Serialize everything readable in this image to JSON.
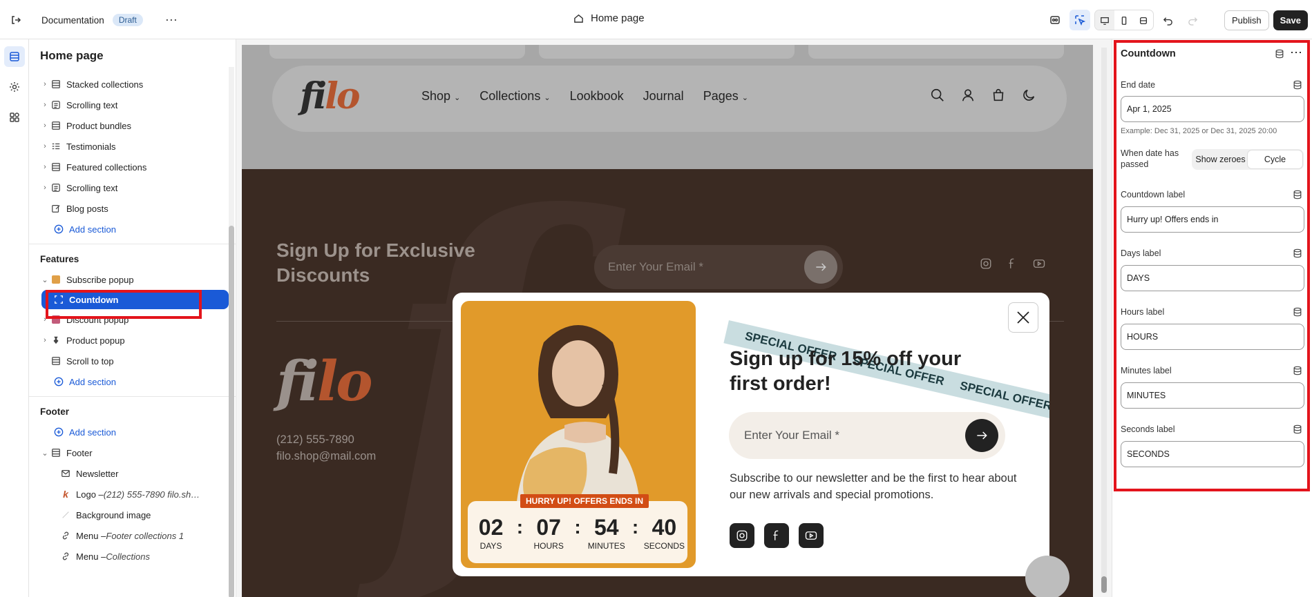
{
  "topbar": {
    "store_name": "Documentation",
    "status_badge": "Draft",
    "page_selector": "Home page",
    "publish_label": "Publish",
    "save_label": "Save"
  },
  "sidebar": {
    "title": "Home page",
    "template_items": [
      {
        "label": "Stacked collections",
        "icon": "stack-icon"
      },
      {
        "label": "Scrolling text",
        "icon": "text-block-icon"
      },
      {
        "label": "Product bundles",
        "icon": "stack-icon"
      },
      {
        "label": "Testimonials",
        "icon": "list-icon"
      },
      {
        "label": "Featured collections",
        "icon": "stack-icon"
      },
      {
        "label": "Scrolling text",
        "icon": "text-block-icon"
      },
      {
        "label": "Blog posts",
        "icon": "edit-icon"
      }
    ],
    "add_section": "Add section",
    "features_title": "Features",
    "features": [
      {
        "label": "Subscribe popup",
        "expanded": true
      },
      {
        "label": "Countdown",
        "child": true,
        "selected": true
      },
      {
        "label": "Discount popup"
      },
      {
        "label": "Product popup"
      },
      {
        "label": "Scroll to top"
      }
    ],
    "footer_title": "Footer",
    "footer_group": "Footer",
    "footer_children": [
      {
        "label": "Newsletter",
        "icon": "mail-icon"
      },
      {
        "label": "Logo – ",
        "italic": "(212) 555-7890 filo.shop...",
        "icon": "logo-k-icon"
      },
      {
        "label": "Background image",
        "icon": "image-icon"
      },
      {
        "label": "Menu – ",
        "italic": "Footer collections 1",
        "icon": "link-icon"
      },
      {
        "label": "Menu – ",
        "italic": "Collections",
        "icon": "link-icon"
      }
    ]
  },
  "preview": {
    "logo": {
      "left": "fi",
      "right": "lo"
    },
    "nav": [
      "Shop",
      "Collections",
      "Lookbook",
      "Journal",
      "Pages"
    ],
    "nav_dropdowns": [
      true,
      true,
      false,
      false,
      true
    ],
    "footer_signup": "Sign Up for Exclusive Discounts",
    "footer_email_placeholder": "Enter Your Email *",
    "phone": "(212) 555-7890",
    "email": "filo.shop@mail.com",
    "popup": {
      "ribbon": "SPECIAL OFFER",
      "title": "Sign up for 15% off your first order!",
      "email_placeholder": "Enter Your Email *",
      "description": "Subscribe to our newsletter and be the first to hear about our new arrivals and special promotions.",
      "countdown_label": "HURRY UP! OFFERS ENDS IN",
      "countdown": [
        {
          "value": "02",
          "unit": "DAYS"
        },
        {
          "value": "07",
          "unit": "HOURS"
        },
        {
          "value": "54",
          "unit": "MINUTES"
        },
        {
          "value": "40",
          "unit": "SECONDS"
        }
      ]
    }
  },
  "inspector": {
    "title": "Countdown",
    "end_date_label": "End date",
    "end_date_value": "Apr 1, 2025",
    "end_date_hint": "Example: Dec 31, 2025 or Dec 31, 2025 20:00",
    "when_passed_label": "When date has passed",
    "when_passed_options": [
      "Show zeroes",
      "Cycle"
    ],
    "when_passed_selected": "Cycle",
    "countdown_label_label": "Countdown label",
    "countdown_label_value": "Hurry up! Offers ends in",
    "days_label": "Days label",
    "days_value": "DAYS",
    "hours_label": "Hours label",
    "hours_value": "HOURS",
    "minutes_label": "Minutes label",
    "minutes_value": "MINUTES",
    "seconds_label": "Seconds label",
    "seconds_value": "SECONDS"
  },
  "colors": {
    "accent": "#1a5ad7",
    "highlight_box": "#e3141c",
    "logo_orange": "#c4532a",
    "footer_bg": "#3a2a22"
  }
}
